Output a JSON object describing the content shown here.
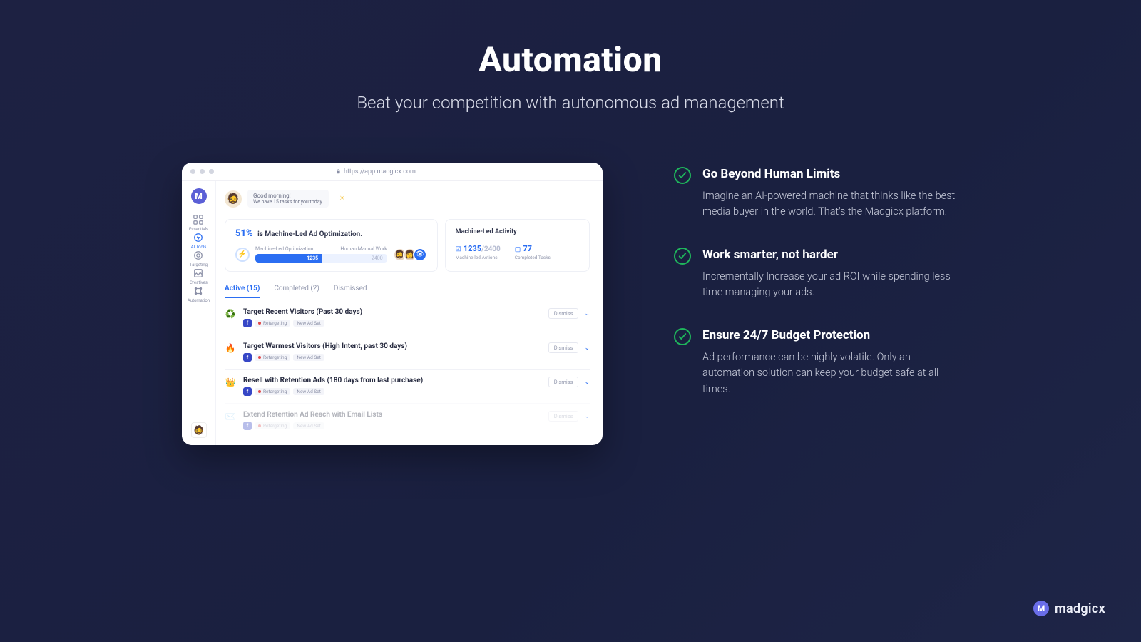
{
  "hero": {
    "title": "Automation",
    "subtitle": "Beat your competition with autonomous ad management"
  },
  "browser": {
    "url": "https://app.madgicx.com"
  },
  "greeting": {
    "line1": "Good morning!",
    "line2": "We have 15 tasks for you today."
  },
  "stats": {
    "percent": "51%",
    "percentLabel": "is Machine-Led Ad Optimization.",
    "leftLabel": "Machine-Led Optimization",
    "rightLabel": "Human Manual Work",
    "fillValue": "1235",
    "totalValue": "2400"
  },
  "activity": {
    "header": "Machine-Led Activity",
    "actionsDone": "1235",
    "actionsTotal": "/2400",
    "actionsLabel": "Machine-led Actions",
    "tasks": "77",
    "tasksLabel": "Completed Tasks"
  },
  "tabs": {
    "active": "Active (15)",
    "completed": "Completed (2)",
    "dismissed": "Dismissed"
  },
  "sidebar": [
    "Essentials",
    "AI Tools",
    "Targeting",
    "Creatives",
    "Automation"
  ],
  "sidebarActiveIndex": 1,
  "tasks": [
    {
      "icon": "♻️",
      "title": "Target Recent Visitors (Past 30 days)",
      "tag1": "Retargeting",
      "tag1color": "#e24a4a",
      "tag2": "New Ad Set",
      "dismiss": "Dismiss",
      "faded": false
    },
    {
      "icon": "🔥",
      "title": "Target Warmest Visitors (High Intent, past 30 days)",
      "tag1": "Retargeting",
      "tag1color": "#e24a4a",
      "tag2": "New Ad Set",
      "dismiss": "Dismiss",
      "faded": false
    },
    {
      "icon": "👑",
      "title": "Resell with Retention Ads (180 days from last purchase)",
      "tag1": "Retargeting",
      "tag1color": "#e24a4a",
      "tag2": "New Ad Set",
      "dismiss": "Dismiss",
      "faded": false
    },
    {
      "icon": "✉️",
      "title": "Extend Retention Ad Reach with Email Lists",
      "tag1": "Retargeting",
      "tag1color": "#e24a4a",
      "tag2": "New Ad Set",
      "dismiss": "Dismiss",
      "faded": true
    }
  ],
  "features": [
    {
      "title": "Go Beyond Human Limits",
      "body": "Imagine an AI-powered machine that thinks like the best media buyer in the world. That's the Madgicx platform."
    },
    {
      "title": "Work smarter, not harder",
      "body": "Incrementally Increase your ad ROI while spending less time managing your ads."
    },
    {
      "title": "Ensure 24/7 Budget Protection",
      "body": "Ad performance can be highly volatile. Only an automation solution can keep your budget safe at all times."
    }
  ],
  "brand": "madgicx"
}
